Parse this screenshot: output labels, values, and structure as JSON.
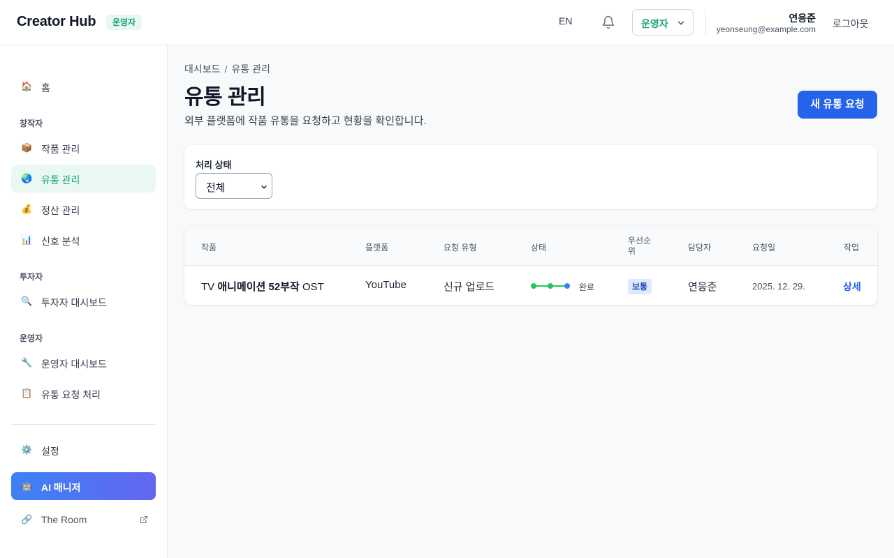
{
  "header": {
    "brand": "Creator Hub",
    "role_badge": "운영자",
    "lang": "EN",
    "role_select": "운영자",
    "user_name": "연응준",
    "user_email": "yeonseung@example.com",
    "logout": "로그아웃"
  },
  "sidebar": {
    "home": "홈",
    "section_creator": "창작자",
    "works": "작품 관리",
    "distribution": "유통 관리",
    "settlement": "정산 관리",
    "analytics": "신호 분석",
    "section_investor": "투자자",
    "investor_dashboard": "투자자 대시보드",
    "section_operator": "운영자",
    "operator_dashboard": "운영자 대시보드",
    "distribution_requests": "유통 요청 처리",
    "settings": "설정",
    "ai_manager": "AI 매니저",
    "the_room": "The Room"
  },
  "main": {
    "breadcrumb_root": "대시보드",
    "breadcrumb_sep": "/",
    "breadcrumb_current": "유통 관리",
    "title": "유통 관리",
    "description": "외부 플랫폼에 작품 유통을 요청하고 현황을 확인합니다.",
    "new_request": "새 유통 요청",
    "filter_label": "처리 상태",
    "filter_value": "전체"
  },
  "table": {
    "columns": {
      "work": "작품",
      "platform": "플랫폼",
      "request_type": "요청 유형",
      "status": "상태",
      "priority": "우선순위",
      "assignee": "담당자",
      "requested_at": "요청일",
      "action": "작업"
    },
    "rows": [
      {
        "work_prefix": "TV ",
        "work_bold": "애니메이션 52부작",
        "work_suffix": " OST",
        "platform": "YouTube",
        "request_type": "신규 업로드",
        "status": "완료",
        "priority": "보통",
        "assignee": "연응준",
        "requested_at": "2025. 12. 29.",
        "action": "상세"
      }
    ]
  },
  "colors": {
    "accent_green": "#16a37a",
    "primary_blue": "#2563eb",
    "status_done": "#22c55e",
    "status_current": "#3b82f6"
  }
}
